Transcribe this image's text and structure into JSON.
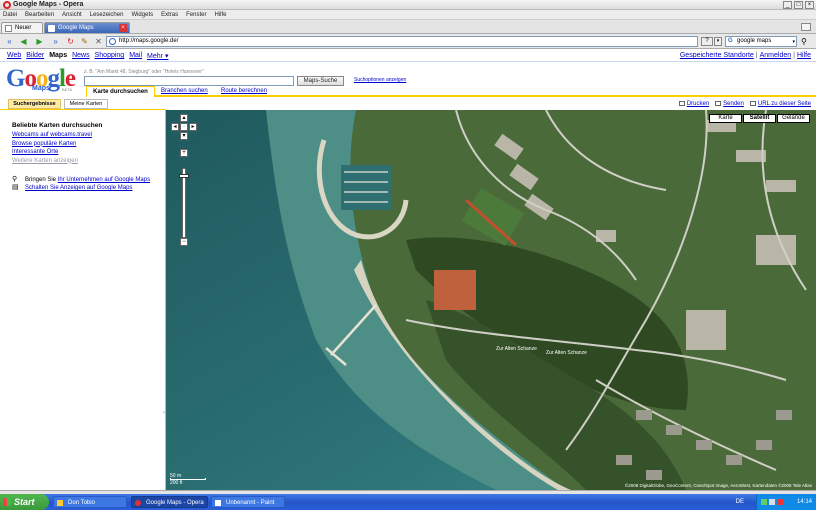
{
  "window": {
    "title": "Google Maps - Opera"
  },
  "menu": [
    "Datei",
    "Bearbeiten",
    "Ansicht",
    "Lesezeichen",
    "Widgets",
    "Extras",
    "Fenster",
    "Hilfe"
  ],
  "tabs": [
    {
      "label": "Neuer Tab"
    },
    {
      "label": "Google Maps"
    }
  ],
  "address": {
    "url": "http://maps.google.de/",
    "search_value": "google maps"
  },
  "gnav": {
    "links": [
      "Web",
      "Bilder",
      "Maps",
      "News",
      "Shopping",
      "Mail",
      "Mehr ▾"
    ],
    "active": "Maps",
    "right": [
      "Gespeicherte Standorte",
      "Anmelden",
      "Hilfe"
    ]
  },
  "logo": {
    "word": "Google",
    "sub": "Maps",
    "beta": "BETA"
  },
  "search": {
    "hint": "z. B. \"Am Markt 48, Siegburg\" oder \"Hotels Hannover\"",
    "value": "",
    "button": "Maps-Suche",
    "options": "Suchoptionen anzeigen"
  },
  "modes": [
    "Karte durchsuchen",
    "Branchen suchen",
    "Route berechnen"
  ],
  "panel_tabs": [
    "Suchergebnisse",
    "Meine Karten"
  ],
  "map_tools": [
    "Drucken",
    "Senden",
    "URL zu dieser Seite"
  ],
  "map_types": [
    "Karte",
    "Satellit",
    "Gelände"
  ],
  "map_type_active": "Satellit",
  "panel": {
    "heading": "Beliebte Karten durchsuchen",
    "links": [
      "Webcams auf webcams.travel",
      "Browse populäre Karten",
      "Interessante Orte"
    ],
    "more": "Weitere Karten anzeigen",
    "promo1_prefix": "Bringen Sie ",
    "promo1_link": "Ihr Unternehmen auf Google Maps",
    "promo2_link": "Schalten Sie Anzeigen auf Google Maps"
  },
  "scale": {
    "metric": "50 m",
    "imperial": "200 ft"
  },
  "copyright": "©2008 DigitalGlobe, GeoContent, Cnes/Spot Image, AeroWest, Kartendaten ©2008 Tele Atlas",
  "streets": [
    "Zur Alten Schanze",
    "Zur Alten Schanze"
  ],
  "taskbar": {
    "start": "Start",
    "tasks": [
      "Don Tobio",
      "Google Maps - Opera",
      "Unbenannt - Paint"
    ],
    "lang": "DE",
    "clock": "14:14"
  },
  "colors": {
    "google_blue": "#3366cc",
    "tab_yellow": "#ffcc00",
    "xp_blue": "#2454c9"
  }
}
